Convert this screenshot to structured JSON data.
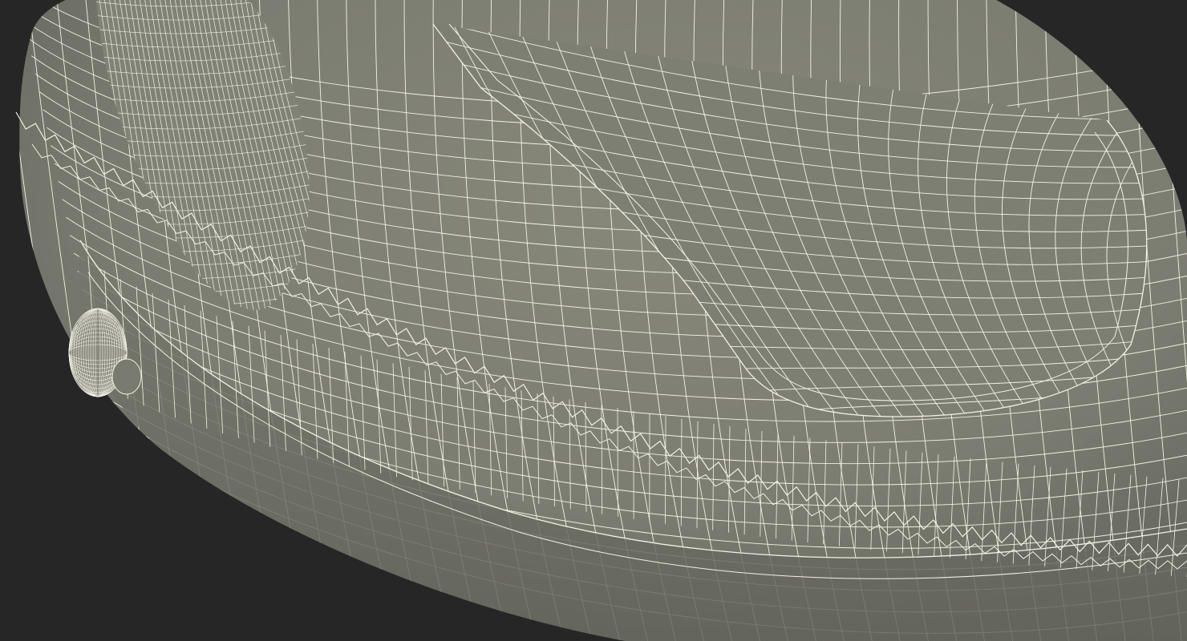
{
  "viewport": {
    "background_color": "#262626"
  },
  "model": {
    "surface_color": "#7c7d72",
    "shadow_color": "#5f6058",
    "wire_color": "#f2f2e6"
  }
}
